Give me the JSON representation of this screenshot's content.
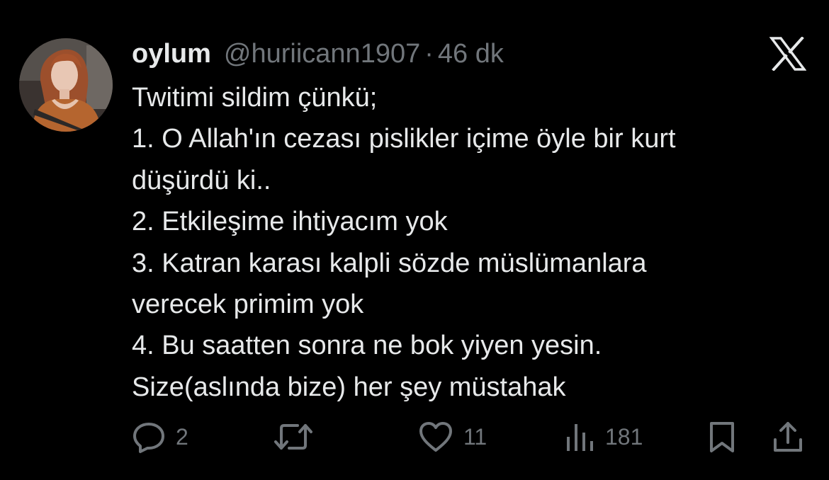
{
  "tweet": {
    "display_name": "oylum",
    "handle": "@huriicann1907",
    "separator": "·",
    "time": "46 dk",
    "lines": [
      "Twitimi sildim çünkü;",
      "1. O Allah'ın cezası pislikler içime öyle bir kurt",
      "düşürdü ki..",
      "2. Etkileşime ihtiyacım yok",
      "3. Katran karası kalpli sözde müslümanlara",
      "verecek primim yok",
      "4. Bu saatten sonra ne bok yiyen yesin.",
      "Size(aslında bize) her şey müstahak"
    ]
  },
  "actions": {
    "replies": "2",
    "retweets": "",
    "likes": "11",
    "views": "181"
  },
  "icons": {
    "brand": "x-logo-icon",
    "reply": "reply-icon",
    "retweet": "retweet-icon",
    "like": "heart-icon",
    "views": "views-icon",
    "bookmark": "bookmark-icon",
    "share": "share-icon"
  },
  "colors": {
    "background": "#000000",
    "text": "#e7e9ea",
    "muted": "#71767b"
  }
}
